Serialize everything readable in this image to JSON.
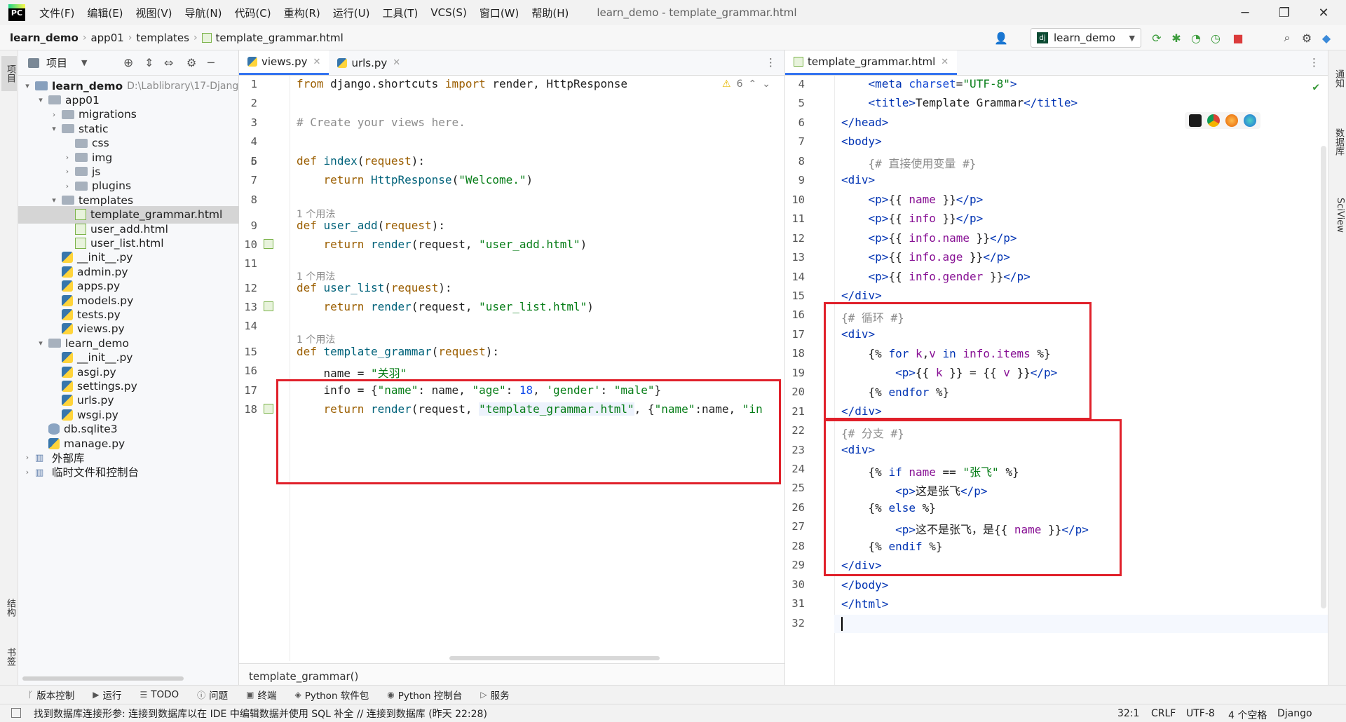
{
  "menubar": {
    "logo_text": "PC",
    "items": [
      "文件(F)",
      "编辑(E)",
      "视图(V)",
      "导航(N)",
      "代码(C)",
      "重构(R)",
      "运行(U)",
      "工具(T)",
      "VCS(S)",
      "窗口(W)",
      "帮助(H)"
    ],
    "window_title": "learn_demo - template_grammar.html"
  },
  "navbar": {
    "breadcrumb": [
      "learn_demo",
      "app01",
      "templates",
      "template_grammar.html"
    ],
    "run_config": "learn_demo"
  },
  "left_strip": {
    "project_tab": "项目",
    "structure_tab": "结构",
    "bookmarks_tab": "书签"
  },
  "right_strip": {
    "notifications_tab": "通知",
    "database_tab": "数据库",
    "sciview_tab": "SciView"
  },
  "project_panel": {
    "header": "项目",
    "root_path": "D:\\Lablibrary\\17-Djang",
    "tree": [
      {
        "label": "learn_demo",
        "depth": 0,
        "type": "root",
        "arrow": "▾"
      },
      {
        "label": "app01",
        "depth": 1,
        "type": "folder",
        "arrow": "▾"
      },
      {
        "label": "migrations",
        "depth": 2,
        "type": "folder",
        "arrow": "›"
      },
      {
        "label": "static",
        "depth": 2,
        "type": "folder",
        "arrow": "▾"
      },
      {
        "label": "css",
        "depth": 3,
        "type": "folder",
        "arrow": ""
      },
      {
        "label": "img",
        "depth": 3,
        "type": "folder",
        "arrow": "›"
      },
      {
        "label": "js",
        "depth": 3,
        "type": "folder",
        "arrow": "›"
      },
      {
        "label": "plugins",
        "depth": 3,
        "type": "folder",
        "arrow": "›"
      },
      {
        "label": "templates",
        "depth": 2,
        "type": "folder",
        "arrow": "▾"
      },
      {
        "label": "template_grammar.html",
        "depth": 3,
        "type": "html",
        "arrow": "",
        "selected": true
      },
      {
        "label": "user_add.html",
        "depth": 3,
        "type": "html",
        "arrow": ""
      },
      {
        "label": "user_list.html",
        "depth": 3,
        "type": "html",
        "arrow": ""
      },
      {
        "label": "__init__.py",
        "depth": 2,
        "type": "py",
        "arrow": ""
      },
      {
        "label": "admin.py",
        "depth": 2,
        "type": "py",
        "arrow": ""
      },
      {
        "label": "apps.py",
        "depth": 2,
        "type": "py",
        "arrow": ""
      },
      {
        "label": "models.py",
        "depth": 2,
        "type": "py",
        "arrow": ""
      },
      {
        "label": "tests.py",
        "depth": 2,
        "type": "py",
        "arrow": ""
      },
      {
        "label": "views.py",
        "depth": 2,
        "type": "py",
        "arrow": ""
      },
      {
        "label": "learn_demo",
        "depth": 1,
        "type": "folder",
        "arrow": "▾"
      },
      {
        "label": "__init__.py",
        "depth": 2,
        "type": "py",
        "arrow": ""
      },
      {
        "label": "asgi.py",
        "depth": 2,
        "type": "py",
        "arrow": ""
      },
      {
        "label": "settings.py",
        "depth": 2,
        "type": "py",
        "arrow": ""
      },
      {
        "label": "urls.py",
        "depth": 2,
        "type": "py",
        "arrow": ""
      },
      {
        "label": "wsgi.py",
        "depth": 2,
        "type": "py",
        "arrow": ""
      },
      {
        "label": "db.sqlite3",
        "depth": 1,
        "type": "db",
        "arrow": ""
      },
      {
        "label": "manage.py",
        "depth": 1,
        "type": "py",
        "arrow": ""
      },
      {
        "label": "外部库",
        "depth": 0,
        "type": "lib",
        "arrow": "›"
      },
      {
        "label": "临时文件和控制台",
        "depth": 0,
        "type": "lib",
        "arrow": "›"
      }
    ]
  },
  "left_editor": {
    "tabs": [
      {
        "label": "views.py",
        "active": true
      },
      {
        "label": "urls.py",
        "active": false
      }
    ],
    "warning_count": "6",
    "breadcrumb_footer": "template_grammar()",
    "usage_hint": "1 个用法",
    "lines": [
      "1",
      "2",
      "3",
      "4",
      "5",
      "6",
      "7",
      "8",
      "9",
      "10",
      "11",
      "12",
      "13",
      "14",
      "15",
      "16",
      "17",
      "18"
    ]
  },
  "right_editor": {
    "tabs": [
      {
        "label": "template_grammar.html",
        "active": true
      }
    ],
    "lines": [
      "4",
      "5",
      "6",
      "7",
      "8",
      "9",
      "10",
      "11",
      "12",
      "13",
      "14",
      "15",
      "16",
      "17",
      "18",
      "19",
      "20",
      "21",
      "22",
      "23",
      "24",
      "25",
      "26",
      "27",
      "28",
      "29",
      "30",
      "31",
      "32"
    ]
  },
  "bottom_tools": [
    "版本控制",
    "运行",
    "TODO",
    "问题",
    "终端",
    "Python 软件包",
    "Python 控制台",
    "服务"
  ],
  "statusbar": {
    "message": "找到数据库连接形参: 连接到数据库以在 IDE 中编辑数据并使用 SQL 补全 // 连接到数据库 (昨天 22:28)",
    "position": "32:1",
    "line_sep": "CRLF",
    "encoding": "UTF-8",
    "indent": "4 个空格",
    "interpreter": "Django"
  }
}
